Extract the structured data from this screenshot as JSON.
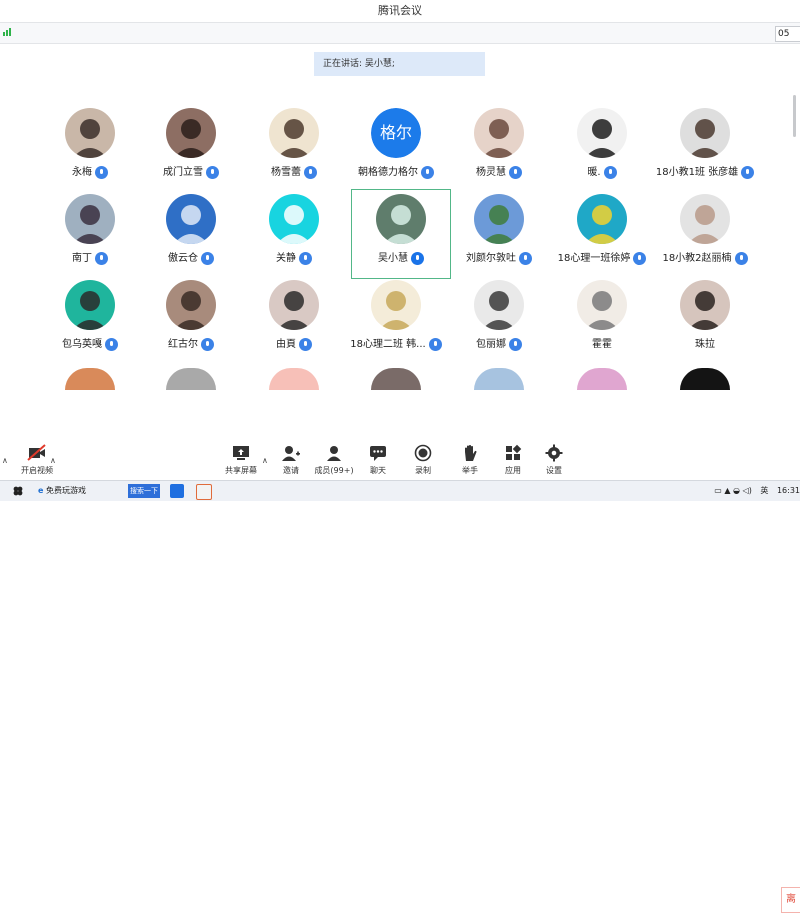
{
  "window": {
    "title": "腾讯会议",
    "corner_time": "05"
  },
  "speaking": {
    "text": "正在讲话: 吴小慧;"
  },
  "participants": [
    {
      "name": "永梅",
      "mic": true,
      "bg": "#c9b7a8",
      "fg": "#3b2f2a"
    },
    {
      "name": "成门立雪",
      "mic": true,
      "bg": "#8d6e63",
      "fg": "#2b1e1a"
    },
    {
      "name": "杨雪蕾",
      "mic": true,
      "bg": "#efe4d0",
      "fg": "#4e3b2e"
    },
    {
      "name": "朝格德力格尔",
      "mic": true,
      "avatar_text": "格尔"
    },
    {
      "name": "杨灵慧",
      "mic": true,
      "bg": "#e6d3c9",
      "fg": "#6b4a3e"
    },
    {
      "name": "暖.",
      "mic": true,
      "bg": "#f1f1f1",
      "fg": "#1d1d1d"
    },
    {
      "name": "18小教1班 张彦雄",
      "mic": true,
      "bg": "#dedede",
      "fg": "#4b3a30"
    },
    {
      "name": "南丁",
      "mic": true,
      "bg": "#9fb0c0",
      "fg": "#3a3040"
    },
    {
      "name": "傲云仓",
      "mic": true,
      "bg": "#2f6fc6",
      "fg": "#dfeaf7"
    },
    {
      "name": "关静",
      "mic": true,
      "bg": "#18d4e0",
      "fg": "#ffffff"
    },
    {
      "name": "吴小慧",
      "mic": true,
      "active": true,
      "bg": "#5f7d6c",
      "fg": "#d7efe6"
    },
    {
      "name": "刘颜尔敦吐",
      "mic": true,
      "bg": "#6c9ad8",
      "fg": "#3f7d3c"
    },
    {
      "name": "18心理一班徐婷",
      "mic": true,
      "bg": "#1fa8c7",
      "fg": "#f2d22e"
    },
    {
      "name": "18小教2赵丽楠",
      "mic": true,
      "bg": "#e3e3e3",
      "fg": "#b99a8a"
    },
    {
      "name": "包乌英嘎",
      "mic": true,
      "bg": "#1fb59d",
      "fg": "#2a2a2a"
    },
    {
      "name": "红古尔",
      "mic": true,
      "bg": "#a88b7c",
      "fg": "#3a2b26"
    },
    {
      "name": "由頁",
      "mic": true,
      "bg": "#d9c9c4",
      "fg": "#2b2b2b"
    },
    {
      "name": "18心理二班 韩...",
      "mic": true,
      "bg": "#f4ecd9",
      "fg": "#c7a95b"
    },
    {
      "name": "包丽娜",
      "mic": true,
      "bg": "#e9e9e9",
      "fg": "#3a3a3a"
    },
    {
      "name": "霍霍",
      "mic": false,
      "bg": "#f1ece6",
      "fg": "#7a7a7a"
    },
    {
      "name": "珠拉",
      "mic": false,
      "bg": "#d6c5bd",
      "fg": "#2a2220"
    }
  ],
  "partial_row": [
    "#d98a5a",
    "#a9a9a9",
    "#f7c0b8",
    "#7a6b68",
    "#a7c3e0",
    "#e0a6d0",
    "#141414"
  ],
  "toolbar": {
    "video": "开启视频",
    "share": "共享屏幕",
    "invite": "邀请",
    "members": "成员(99+)",
    "chat": "聊天",
    "record": "录制",
    "raise": "举手",
    "apps": "应用",
    "settings": "设置",
    "leave": "离"
  },
  "taskbar": {
    "ie_label": "免费玩游戏",
    "search_label": "搜索一下",
    "ime": "英",
    "time": "16:31"
  }
}
